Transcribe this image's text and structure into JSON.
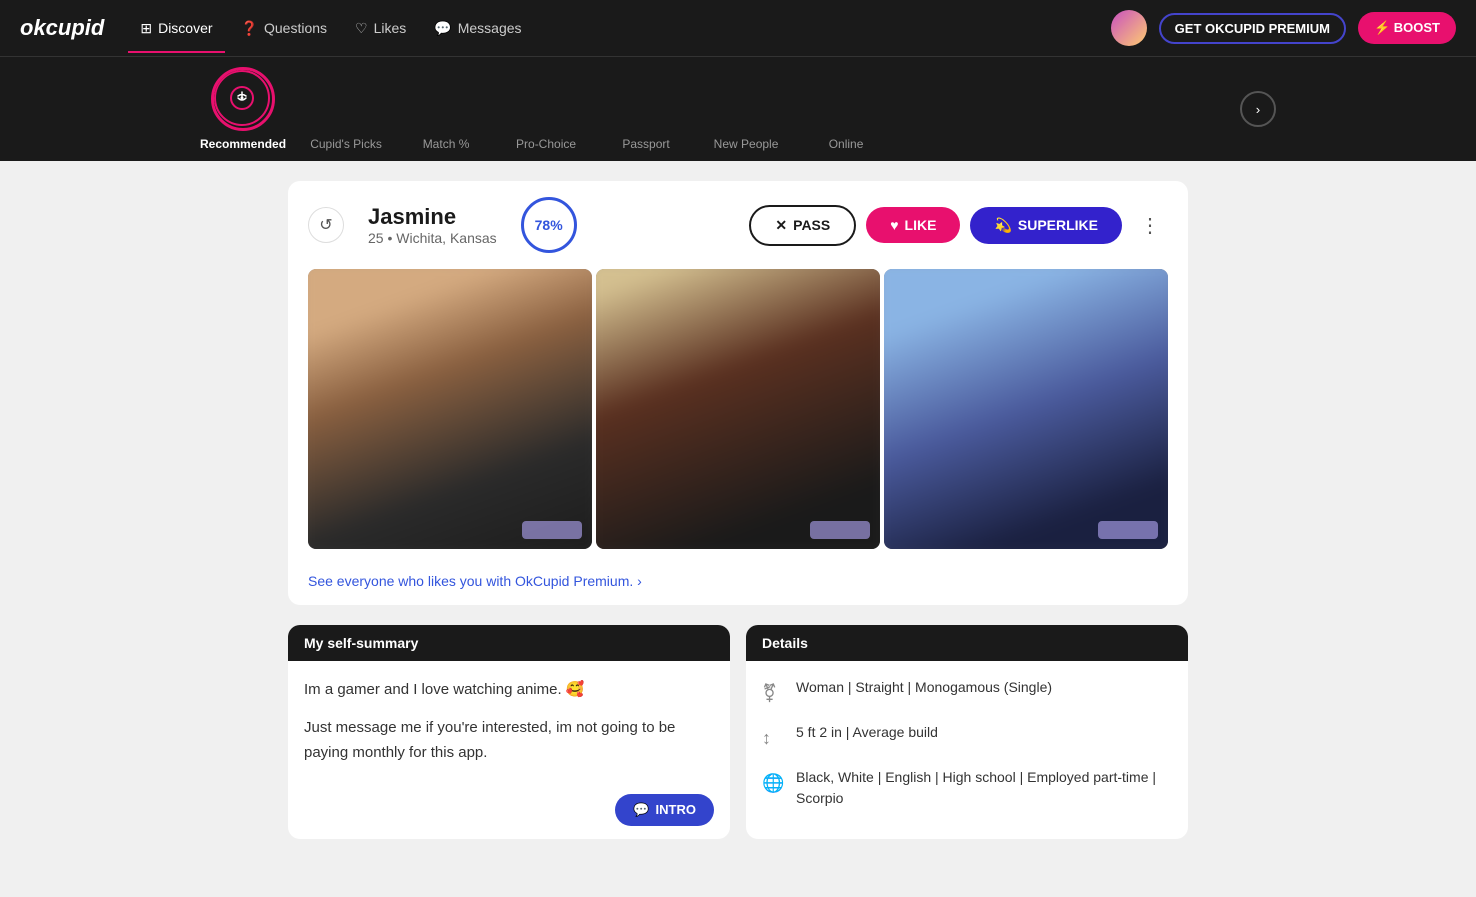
{
  "app": {
    "logo": "okcupid",
    "premium_label": "GET OKCUPID PREMIUM",
    "boost_label": "⚡ BOOST"
  },
  "nav": {
    "items": [
      {
        "id": "discover",
        "label": "Discover",
        "active": true
      },
      {
        "id": "questions",
        "label": "Questions",
        "active": false
      },
      {
        "id": "likes",
        "label": "Likes",
        "active": false
      },
      {
        "id": "messages",
        "label": "Messages",
        "active": false
      }
    ]
  },
  "categories": [
    {
      "id": "recommended",
      "label": "Recommended",
      "active": true
    },
    {
      "id": "cupids-picks",
      "label": "Cupid's Picks",
      "active": false
    },
    {
      "id": "match",
      "label": "Match %",
      "active": false
    },
    {
      "id": "pro-choice",
      "label": "Pro-Choice",
      "active": false
    },
    {
      "id": "passport",
      "label": "Passport",
      "active": false
    },
    {
      "id": "new-people",
      "label": "New People",
      "active": false
    },
    {
      "id": "online",
      "label": "Online",
      "active": false
    }
  ],
  "profile": {
    "name": "Jasmine",
    "age": "25",
    "location": "Wichita, Kansas",
    "match_pct": "78%",
    "pass_label": "PASS",
    "like_label": "LIKE",
    "superlike_label": "SUPERLIKE",
    "premium_link": "See everyone who likes you with OkCupid Premium. ›",
    "self_summary_header": "My self-summary",
    "self_summary_text1": "Im a gamer and I love watching anime. 🥰",
    "self_summary_text2": "Just message me if you're interested, im not going to be paying monthly for this app.",
    "intro_label": "INTRO",
    "details_header": "Details",
    "details": [
      {
        "icon": "♀",
        "text": "Woman | Straight | Monogamous (Single)"
      },
      {
        "icon": "↕",
        "text": "5 ft 2 in | Average build"
      },
      {
        "icon": "🌐",
        "text": "Black, White | English | High school | Employed part-time | Scorpio"
      }
    ]
  }
}
